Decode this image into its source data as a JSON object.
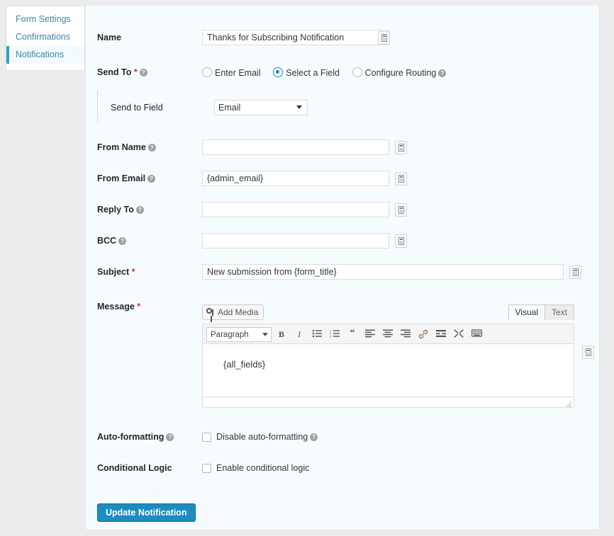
{
  "sidebar": {
    "items": [
      {
        "label": "Form Settings",
        "active": false
      },
      {
        "label": "Confirmations",
        "active": false
      },
      {
        "label": "Notifications",
        "active": true
      }
    ]
  },
  "form": {
    "name": {
      "label": "Name",
      "value": "Thanks for Subscribing Notification",
      "merge_tag_icon": "merge-tag-icon"
    },
    "send_to": {
      "label": "Send To",
      "required": "*",
      "help_icon": "help-icon",
      "options": [
        {
          "label": "Enter Email",
          "checked": false
        },
        {
          "label": "Select a Field",
          "checked": true
        },
        {
          "label": "Configure Routing",
          "checked": false,
          "help_icon": "help-icon"
        }
      ]
    },
    "send_to_field": {
      "label": "Send to Field",
      "selected": "Email",
      "options": [
        "Email"
      ]
    },
    "from_name": {
      "label": "From Name",
      "value": "",
      "placeholder": ""
    },
    "from_email": {
      "label": "From Email",
      "value": "{admin_email}"
    },
    "reply_to": {
      "label": "Reply To",
      "value": ""
    },
    "bcc": {
      "label": "BCC",
      "value": ""
    },
    "subject": {
      "label": "Subject",
      "required": "*",
      "value": "New submission from {form_title}"
    },
    "message": {
      "label": "Message",
      "required": "*",
      "add_media_label": "Add Media",
      "tabs": [
        {
          "label": "Visual",
          "active": true
        },
        {
          "label": "Text",
          "active": false
        }
      ],
      "format_select": {
        "selected": "Paragraph",
        "options": [
          "Paragraph"
        ]
      },
      "toolbar_buttons": [
        "bold-icon",
        "italic-icon",
        "bulleted-list-icon",
        "numbered-list-icon",
        "blockquote-icon",
        "align-left-icon",
        "align-center-icon",
        "align-right-icon",
        "link-icon",
        "read-more-icon",
        "fullscreen-icon",
        "toolbar-toggle-icon"
      ],
      "body": "{all_fields}"
    },
    "auto_formatting": {
      "label": "Auto-formatting",
      "checkbox_label": "Disable auto-formatting",
      "checked": false
    },
    "conditional_logic": {
      "label": "Conditional Logic",
      "checkbox_label": "Enable conditional logic",
      "checked": false
    },
    "submit_label": "Update Notification"
  },
  "colors": {
    "accent": "#1e8cbe",
    "active_nav": "#2ea2cc",
    "panel_bg": "#f6fbfd",
    "page_bg": "#ededed",
    "link": "#3a87ad",
    "required": "#c0392b"
  }
}
